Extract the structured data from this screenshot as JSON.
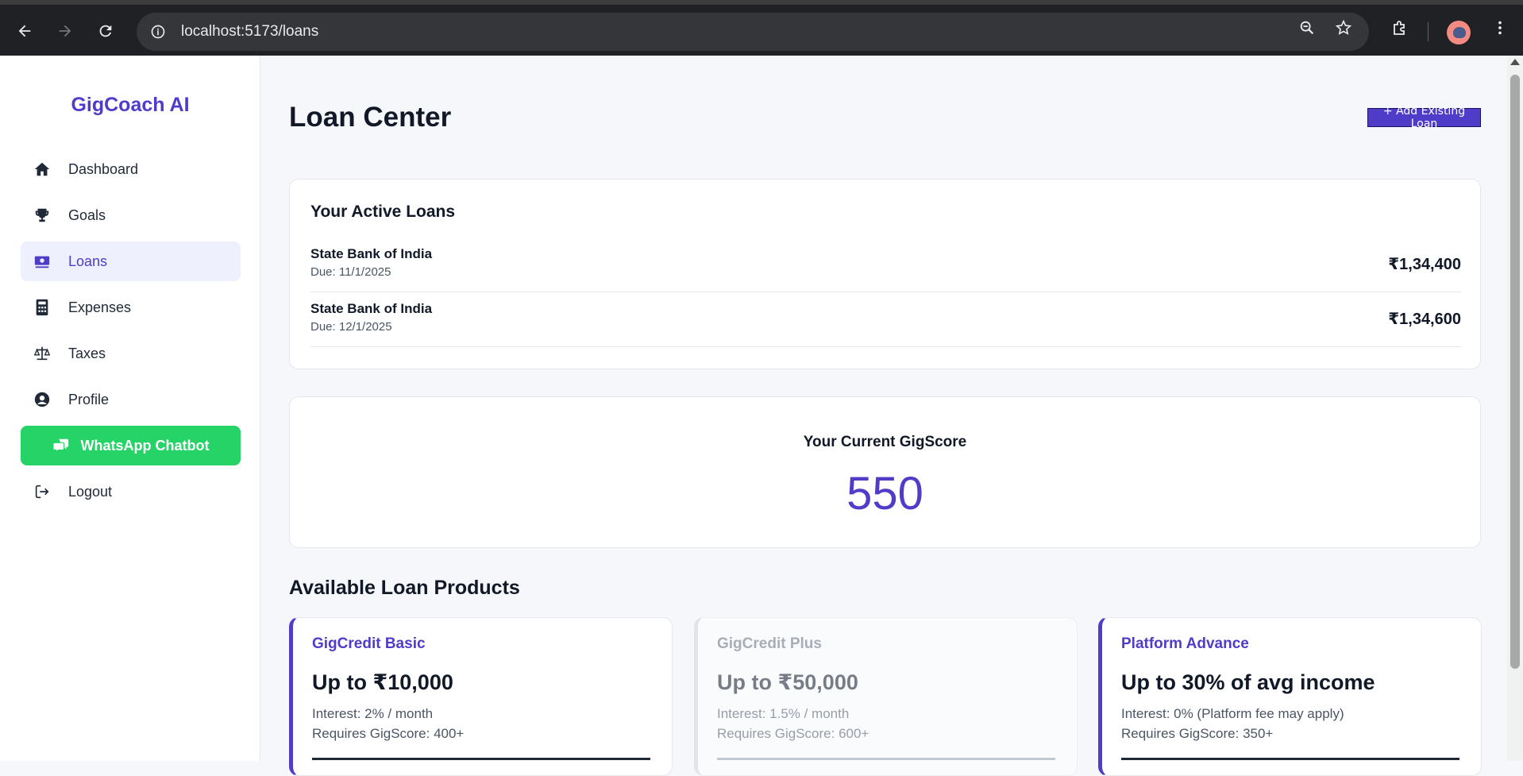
{
  "browser": {
    "url": "localhost:5173/loans",
    "icons": [
      "back-arrow-icon",
      "forward-arrow-icon",
      "reload-icon",
      "site-info-icon",
      "zoom-icon",
      "star-icon",
      "extensions-icon",
      "profile-avatar",
      "kebab-menu-icon"
    ]
  },
  "sidebar": {
    "brand": "GigCoach AI",
    "items": [
      {
        "label": "Dashboard",
        "icon": "home-icon"
      },
      {
        "label": "Goals",
        "icon": "trophy-icon"
      },
      {
        "label": "Loans",
        "icon": "money-icon",
        "active": true
      },
      {
        "label": "Expenses",
        "icon": "calculator-icon"
      },
      {
        "label": "Taxes",
        "icon": "scale-icon"
      },
      {
        "label": "Profile",
        "icon": "user-circle-icon"
      },
      {
        "label": "WhatsApp Chatbot",
        "icon": "chat-icon"
      },
      {
        "label": "Logout",
        "icon": "logout-icon"
      }
    ]
  },
  "main": {
    "title": "Loan Center",
    "add_button": "+ Add Existing Loan",
    "active_loans": {
      "title": "Your Active Loans",
      "rows": [
        {
          "lender": "State Bank of India",
          "due": "Due: 11/1/2025",
          "amount": "₹1,34,400"
        },
        {
          "lender": "State Bank of India",
          "due": "Due: 12/1/2025",
          "amount": "₹1,34,600"
        }
      ]
    },
    "gigscore": {
      "label": "Your Current GigScore",
      "value": "550"
    },
    "products_title": "Available Loan Products",
    "products": [
      {
        "name": "GigCredit Basic",
        "limit": "Up to ₹10,000",
        "interest": "Interest: 2% / month",
        "requirement": "Requires GigScore: 400+"
      },
      {
        "name": "GigCredit Plus",
        "limit": "Up to ₹50,000",
        "interest": "Interest: 1.5% / month",
        "requirement": "Requires GigScore: 600+"
      },
      {
        "name": "Platform Advance",
        "limit": "Up to 30% of avg income",
        "interest": "Interest: 0% (Platform fee may apply)",
        "requirement": "Requires GigScore: 350+"
      }
    ]
  },
  "colors": {
    "accent": "#4f3cc9",
    "whatsapp": "#25d366",
    "active_bg": "#eef0fe"
  }
}
